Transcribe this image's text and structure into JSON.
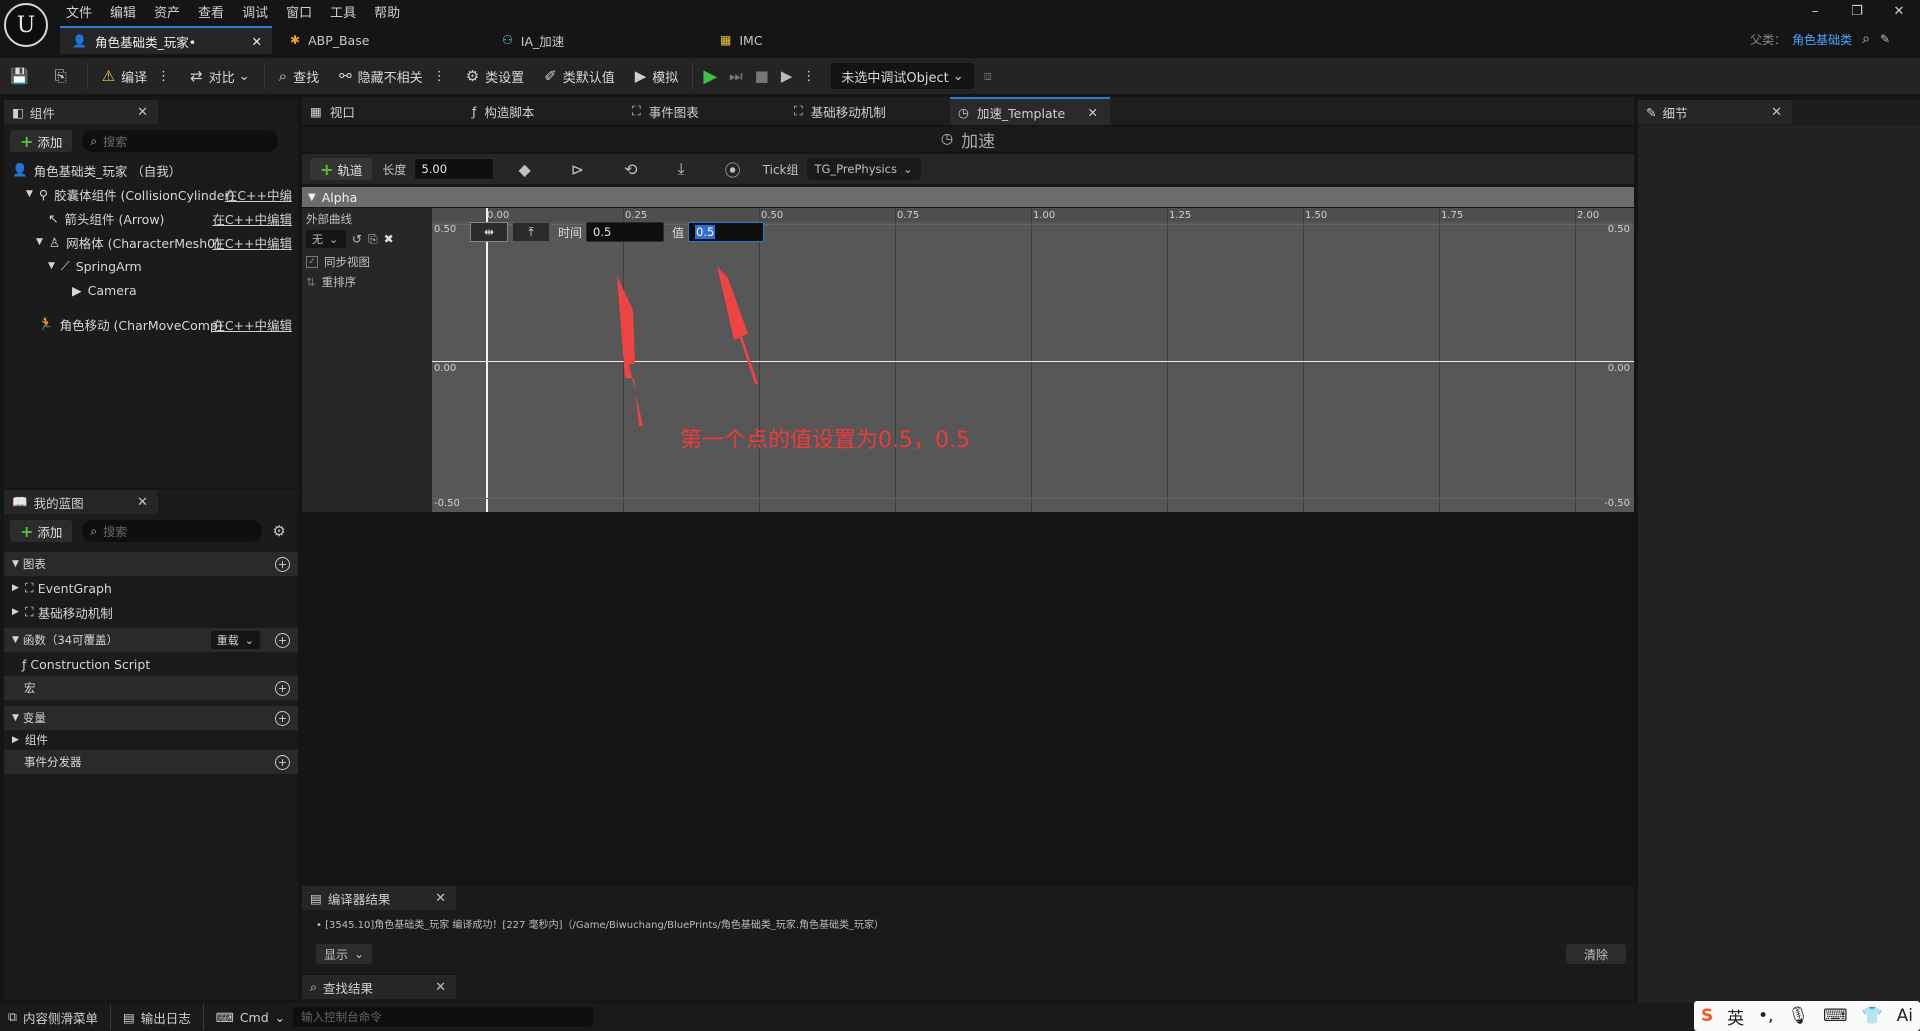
{
  "menu": [
    "文件",
    "编辑",
    "资产",
    "查看",
    "调试",
    "窗口",
    "工具",
    "帮助"
  ],
  "doc_tabs": [
    {
      "label": "角色基础类_玩家•",
      "icon": "person-icon"
    },
    {
      "label": "ABP_Base",
      "icon": "anim-icon"
    },
    {
      "label": "IA_加速",
      "icon": "input-action-icon"
    },
    {
      "label": "IMC",
      "icon": "input-mapping-icon"
    }
  ],
  "parent_class": {
    "label": "父类：",
    "value": "角色基础类"
  },
  "toolbar": {
    "compile": "编译",
    "diff": "对比",
    "find": "查找",
    "hide_unrelated": "隐藏不相关",
    "class_settings": "类设置",
    "class_defaults": "类默认值",
    "simulate": "模拟",
    "debug_object": "未选中调试Object"
  },
  "components_panel": {
    "title": "组件",
    "add": "添加",
    "search_placeholder": "搜索",
    "items": [
      {
        "label": "角色基础类_玩家 （自我）",
        "link": ""
      },
      {
        "label": "胶囊体组件 (CollisionCylinder)",
        "link": "在C++中编"
      },
      {
        "label": "箭头组件 (Arrow)",
        "link": "在C++中编辑"
      },
      {
        "label": "网格体 (CharacterMesh0)",
        "link": "在C++中编辑"
      },
      {
        "label": "SpringArm",
        "link": ""
      },
      {
        "label": "Camera",
        "link": ""
      },
      {
        "label": "角色移动 (CharMoveComp)",
        "link": "在C++中编辑"
      }
    ]
  },
  "my_blueprint": {
    "title": "我的蓝图",
    "add": "添加",
    "search_placeholder": "搜索",
    "graphs_header": "图表",
    "graphs": [
      "EventGraph",
      "基础移动机制"
    ],
    "functions_header": "函数（34可覆盖）",
    "override": "重载",
    "functions": [
      "Construction Script"
    ],
    "macros": "宏",
    "variables": "变量",
    "variables_sub": "组件",
    "dispatchers": "事件分发器"
  },
  "editor_tabs": [
    "视口",
    "构造脚本",
    "事件图表",
    "基础移动机制",
    "加速_Template"
  ],
  "timeline": {
    "title": "加速",
    "add_track": "轨道",
    "length_label": "长度",
    "length_value": "5.00",
    "tick_group_label": "Tick组",
    "tick_group_value": "TG_PrePhysics",
    "track_name": "Alpha",
    "external_curve": "外部曲线",
    "curve_select": "无",
    "sync_view": "同步视图",
    "reorder": "重排序",
    "time_label": "时间",
    "time_value": "0.5",
    "value_label": "值",
    "value_value": "0.5",
    "x_ticks": [
      "0.00",
      "0.25",
      "0.50",
      "0.75",
      "1.00",
      "1.25",
      "1.50",
      "1.75",
      "2.00"
    ],
    "y_top": "0.50",
    "y_mid": "0.00",
    "y_bottom": "-0.50"
  },
  "annotation": "第一个点的值设置为0.5，0.5",
  "details_panel": {
    "title": "细节"
  },
  "compiler_results": {
    "title": "编译器结果",
    "log": "[3545.10]角色基础类_玩家 编译成功！[227 毫秒内]（/Game/Biwuchang/BluePrints/角色基础类_玩家.角色基础类_玩家）",
    "show": "显示",
    "clear": "清除"
  },
  "find_results": {
    "title": "查找结果"
  },
  "status_bar": {
    "content_drawer": "内容侧滑菜单",
    "output_log": "输出日志",
    "cmd": "Cmd",
    "console_placeholder": "输入控制台命令"
  },
  "ime": [
    "S",
    "英",
    "•,",
    "mic",
    "kbd",
    "shirt",
    "Ai"
  ]
}
